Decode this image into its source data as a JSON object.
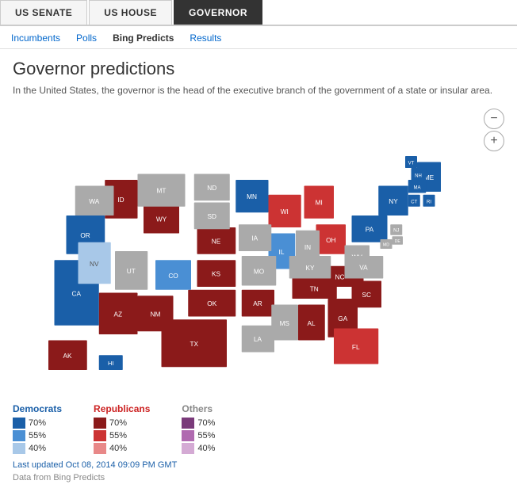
{
  "topNav": {
    "items": [
      {
        "id": "us-senate",
        "label": "US SENATE",
        "active": false
      },
      {
        "id": "us-house",
        "label": "US HOUSE",
        "active": false
      },
      {
        "id": "governor",
        "label": "GOVERNOR",
        "active": true
      }
    ]
  },
  "subNav": {
    "items": [
      {
        "id": "incumbents",
        "label": "Incumbents",
        "active": false
      },
      {
        "id": "polls",
        "label": "Polls",
        "active": false
      },
      {
        "id": "bing-predicts",
        "label": "Bing Predicts",
        "active": true
      },
      {
        "id": "results",
        "label": "Results",
        "active": false
      }
    ]
  },
  "page": {
    "title": "Governor predictions",
    "description": "In the United States, the governor is the head of the executive branch of the government of a state or insular area."
  },
  "mapControls": {
    "zoomOut": "−",
    "zoomIn": "+"
  },
  "legend": {
    "democrats": {
      "title": "Democrats",
      "items": [
        {
          "label": "70%",
          "color": "#1a5fa8"
        },
        {
          "label": "55%",
          "color": "#4a8fd4"
        },
        {
          "label": "40%",
          "color": "#a8c8e8"
        }
      ]
    },
    "republicans": {
      "title": "Republicans",
      "items": [
        {
          "label": "70%",
          "color": "#8b1a1a"
        },
        {
          "label": "55%",
          "color": "#cc3333"
        },
        {
          "label": "40%",
          "color": "#e88888"
        }
      ]
    },
    "others": {
      "title": "Others",
      "items": [
        {
          "label": "70%",
          "color": "#7a3a7a"
        },
        {
          "label": "55%",
          "color": "#b06ab0"
        },
        {
          "label": "40%",
          "color": "#d4aad4"
        }
      ]
    }
  },
  "footer": {
    "lastUpdated": "Last updated Oct 08, 2014 09:09 PM GMT",
    "dataSource": "Data from Bing Predicts"
  }
}
